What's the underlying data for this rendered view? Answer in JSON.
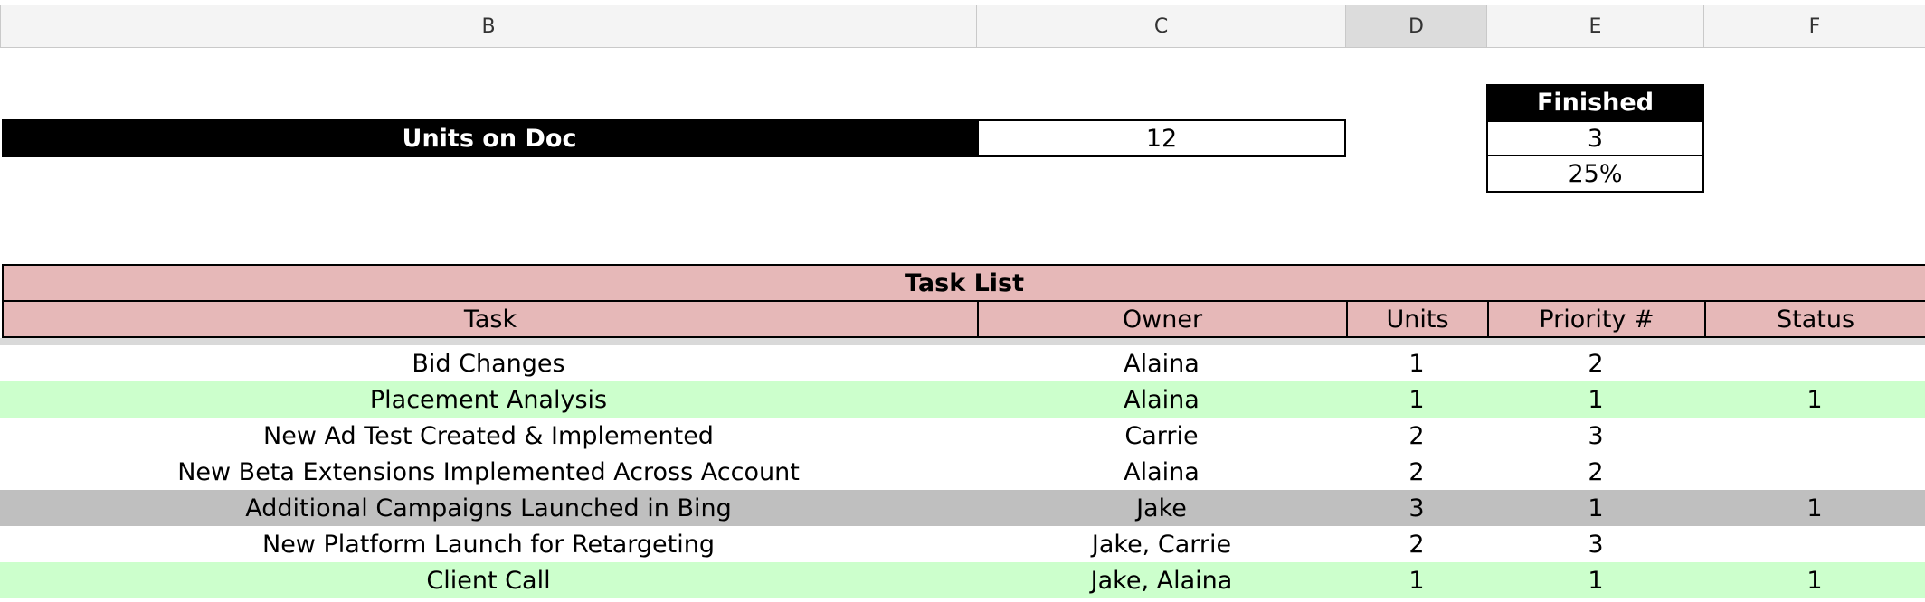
{
  "columns": [
    "B",
    "C",
    "D",
    "E",
    "F"
  ],
  "summary": {
    "units_label": "Units on Doc",
    "units_value": "12",
    "finished_label": "Finished",
    "finished_count": "3",
    "finished_pct": "25%"
  },
  "task_list": {
    "title": "Task List",
    "headers": [
      "Task",
      "Owner",
      "Units",
      "Priority #",
      "Status"
    ],
    "rows": [
      {
        "task": "Bid Changes",
        "owner": "Alaina",
        "units": "1",
        "priority": "2",
        "status": "",
        "highlight": "none"
      },
      {
        "task": "Placement Analysis",
        "owner": "Alaina",
        "units": "1",
        "priority": "1",
        "status": "1",
        "highlight": "green"
      },
      {
        "task": "New Ad Test Created & Implemented",
        "owner": "Carrie",
        "units": "2",
        "priority": "3",
        "status": "",
        "highlight": "none"
      },
      {
        "task": "New Beta Extensions Implemented Across Account",
        "owner": "Alaina",
        "units": "2",
        "priority": "2",
        "status": "",
        "highlight": "none"
      },
      {
        "task": "Additional Campaigns Launched in Bing",
        "owner": "Jake",
        "units": "3",
        "priority": "1",
        "status": "1",
        "highlight": "gray"
      },
      {
        "task": "New Platform Launch for Retargeting",
        "owner": "Jake, Carrie",
        "units": "2",
        "priority": "3",
        "status": "",
        "highlight": "none"
      },
      {
        "task": "Client Call",
        "owner": "Jake, Alaina",
        "units": "1",
        "priority": "1",
        "status": "1",
        "highlight": "green"
      }
    ]
  },
  "colors": {
    "header_pink": "#e6b8b8",
    "done_green": "#ccffcc",
    "in_progress_gray": "#bfbfbf",
    "label_black": "#000000"
  }
}
